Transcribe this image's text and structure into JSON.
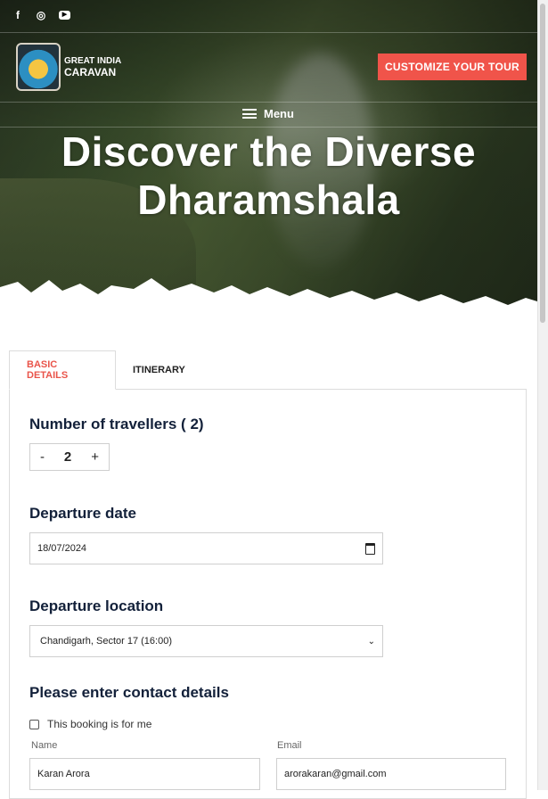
{
  "header": {
    "social": [
      "facebook-icon",
      "instagram-icon",
      "youtube-icon"
    ],
    "logo_line1": "GREAT INDIA",
    "logo_line2": "CARAVAN",
    "cta_label": "CUSTOMIZE YOUR TOUR",
    "menu_label": "Menu"
  },
  "hero": {
    "title": "Discover the Diverse Dharamshala"
  },
  "tabs": [
    {
      "label": "BASIC DETAILS",
      "active": true
    },
    {
      "label": "ITINERARY",
      "active": false
    }
  ],
  "form": {
    "travellers_heading": "Number of travellers ( 2)",
    "minus": "-",
    "count": "2",
    "plus": "+",
    "departure_date_heading": "Departure date",
    "departure_date_value": "18/07/2024",
    "departure_location_heading": "Departure location",
    "departure_location_value": "Chandigarh, Sector 17 (16:00)",
    "contact_heading": "Please enter contact details",
    "booking_for_me": "This booking is for me",
    "name_label": "Name",
    "name_value": "Karan Arora",
    "email_label": "Email",
    "email_value": "arorakaran@gmail.com"
  },
  "colors": {
    "accent": "#f0544a",
    "heading": "#13213a"
  }
}
